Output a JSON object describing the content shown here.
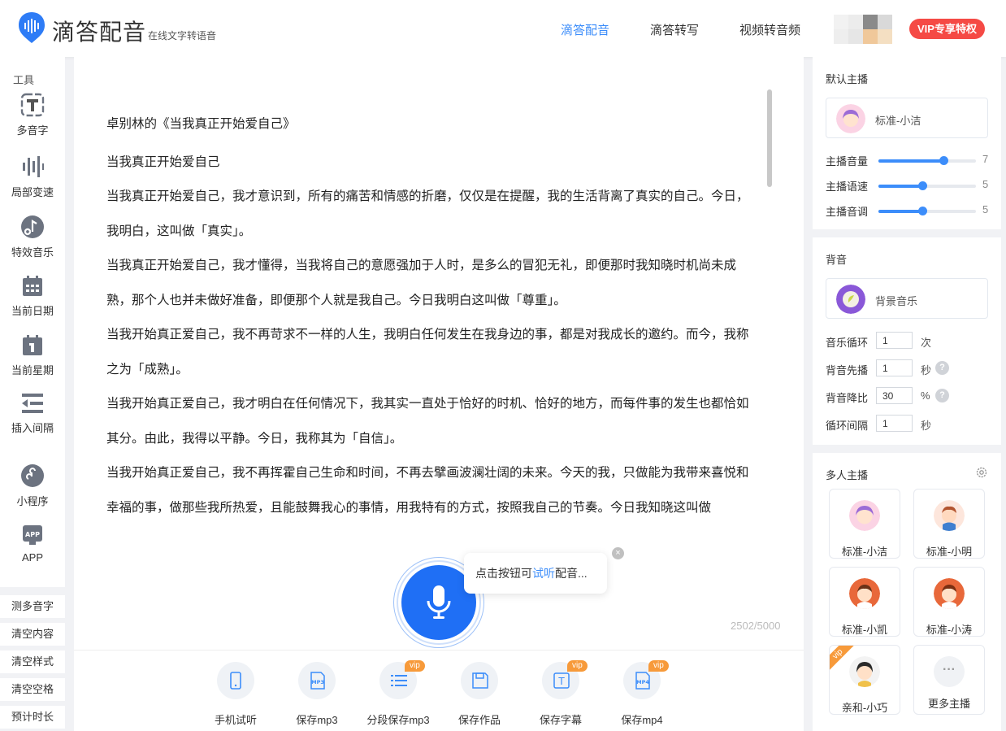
{
  "header": {
    "brand": "滴答配音",
    "tagline": "在线文字转语音",
    "nav": [
      "滴答配音",
      "滴答转写",
      "视频转音频"
    ],
    "vip_button": "VIP专享特权",
    "accent": "#3c8dfa"
  },
  "sidebar": {
    "title": "工具",
    "tools": [
      "多音字",
      "局部变速",
      "特效音乐",
      "当前日期",
      "当前星期",
      "插入间隔",
      "小程序",
      "APP"
    ],
    "actions": [
      "测多音字",
      "清空内容",
      "清空样式",
      "清空空格",
      "预计时长"
    ]
  },
  "editor": {
    "paragraphs": [
      "卓别林的《当我真正开始爱自己》",
      "当我真正开始爱自己",
      "当我真正开始爱自己，我才意识到，所有的痛苦和情感的折磨，仅仅是在提醒，我的生活背离了真实的自己。今日，我明白，这叫做「真实」。",
      "当我真正开始爱自己，我才懂得，当我将自己的意愿强加于人时，是多么的冒犯无礼，即便那时我知晓时机尚未成熟，那个人也并未做好准备，即便那个人就是我自己。今日我明白这叫做「尊重」。",
      "当我开始真正爱自己，我不再苛求不一样的人生，我明白任何发生在我身边的事，都是对我成长的邀约。而今，我称之为「成熟」。",
      "当我开始真正爱自己，我才明白在任何情况下，我其实一直处于恰好的时机、恰好的地方，而每件事的发生也都恰如其分。由此，我得以平静。今日，我称其为「自信」。",
      "当我开始真正爱自己，我不再挥霍自己生命和时间，不再去擘画波澜壮阔的未来。今天的我，只做能为我带来喜悦和幸福的事，做那些我所热爱，且能鼓舞我心的事情，用我特有的方式，按照我自己的节奏。今日我知晓这叫做"
    ],
    "tip_prefix": "点击按钮可",
    "tip_highlight": "试听",
    "tip_suffix": "配音...",
    "tip_close": "×",
    "char_count": "2502/5000"
  },
  "toolbar": {
    "items": [
      {
        "label": "手机试听",
        "vip": ""
      },
      {
        "label": "保存mp3",
        "vip": "",
        "icon_text": "MP3"
      },
      {
        "label": "分段保存mp3",
        "vip": "vip"
      },
      {
        "label": "保存作品",
        "vip": ""
      },
      {
        "label": "保存字幕",
        "vip": "vip",
        "icon_text": "T"
      },
      {
        "label": "保存mp4",
        "vip": "vip",
        "icon_text": "MP4"
      }
    ]
  },
  "default_anchor": {
    "title": "默认主播",
    "name": "标准-小洁",
    "sliders": [
      {
        "label": "主播音量",
        "value": 7,
        "fraction": 0.67
      },
      {
        "label": "主播语速",
        "value": 5,
        "fraction": 0.45
      },
      {
        "label": "主播音调",
        "value": 5,
        "fraction": 0.45
      }
    ]
  },
  "bgm": {
    "title": "背音",
    "name": "背景音乐",
    "fields": [
      {
        "label": "音乐循环",
        "value": "1",
        "unit": "次",
        "help": false
      },
      {
        "label": "背音先播",
        "value": "1",
        "unit": "秒",
        "help": true
      },
      {
        "label": "背音降比",
        "value": "30",
        "unit": "%",
        "help": true
      },
      {
        "label": "循环间隔",
        "value": "1",
        "unit": "秒",
        "help": false
      }
    ]
  },
  "multi_anchor": {
    "title": "多人主播",
    "anchors": [
      {
        "name": "标准-小洁",
        "vip": ""
      },
      {
        "name": "标准-小明",
        "vip": ""
      },
      {
        "name": "标准-小凯",
        "vip": ""
      },
      {
        "name": "标准-小涛",
        "vip": ""
      },
      {
        "name": "亲和-小巧",
        "vip": "vip"
      },
      {
        "name": "更多主播",
        "vip": "",
        "icon": "···"
      }
    ]
  }
}
